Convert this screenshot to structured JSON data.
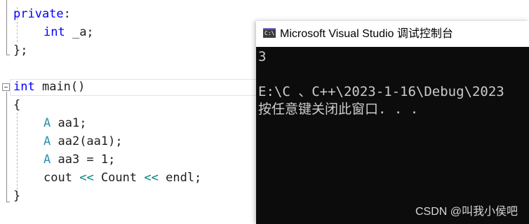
{
  "editor": {
    "l1": {
      "kw": "private",
      "rest": ":"
    },
    "l2": {
      "kw": "int",
      "rest": " _a;"
    },
    "l3": {
      "text": "};"
    },
    "l4": {
      "kw": "int",
      "name": "main",
      "rest": "()"
    },
    "l5": {
      "text": "{"
    },
    "l6": {
      "type": "A",
      "rest": " aa1;"
    },
    "l7": {
      "type": "A",
      "rest": " aa2(aa1);"
    },
    "l8": {
      "type": "A",
      "rest": " aa3 = 1;"
    },
    "l9": {
      "a": "cout",
      "op1": "<<",
      "b": "Count",
      "op2": "<<",
      "c": "endl;"
    },
    "l10": {
      "text": "}"
    }
  },
  "console": {
    "title": "Microsoft Visual Studio 调试控制台",
    "icon_text": "C:\\",
    "lines": [
      "3",
      "",
      "E:\\C 、C++\\2023-1-16\\Debug\\2023",
      "按任意键关闭此窗口. . ."
    ]
  },
  "watermark": "CSDN @叫我小侯吧",
  "colors": {
    "keyword": "#0000ff",
    "type": "#2b91af",
    "operator": "#008080",
    "console_bg": "#0c0c0c",
    "console_text": "#cccccc"
  }
}
